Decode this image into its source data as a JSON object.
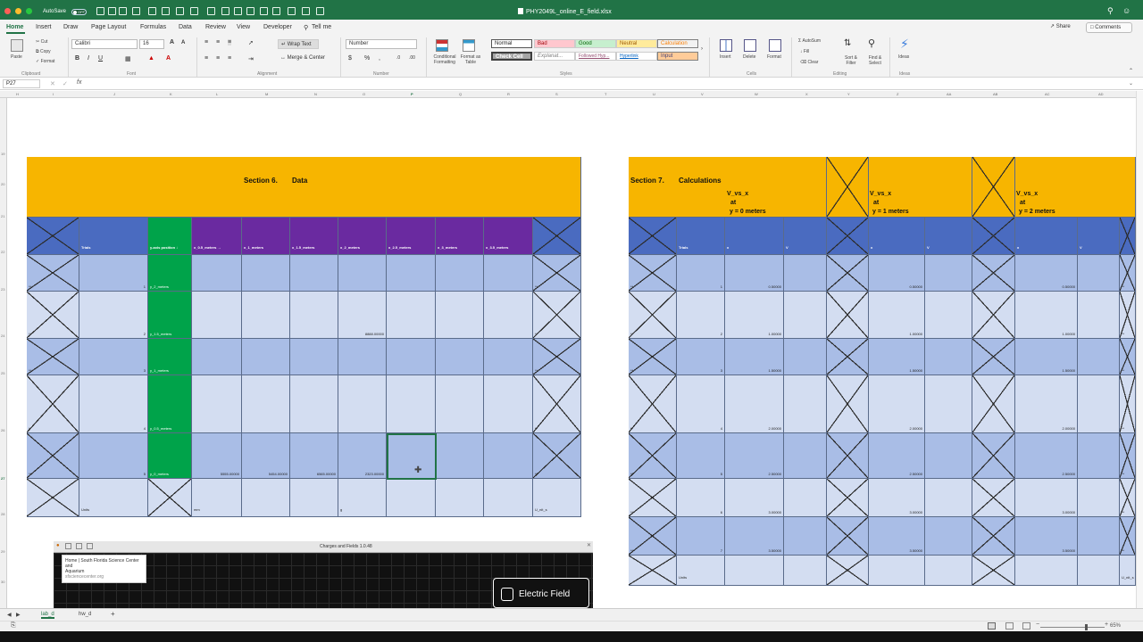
{
  "titlebar": {
    "autosave_label": "AutoSave",
    "autosave_state": "OFF",
    "document_title": "PHY2049L_online_E_field.xlsx"
  },
  "tabs": [
    "Home",
    "Insert",
    "Draw",
    "Page Layout",
    "Formulas",
    "Data",
    "Review",
    "View",
    "Developer",
    "Tell me"
  ],
  "share_label": "Share",
  "comments_label": "Comments",
  "ribbon": {
    "paste": "Paste",
    "cut": "Cut",
    "copy": "Copy",
    "format": "Format",
    "clipboard": "Clipboard",
    "font_name": "Calibri",
    "font_size": "16",
    "font_group": "Font",
    "wrap_text": "Wrap Text",
    "merge_center": "Merge & Center",
    "alignment_group": "Alignment",
    "number_format": "Number",
    "number_group": "Number",
    "conditional_formatting": "Conditional Formatting",
    "format_as_table": "Format as Table",
    "styles_group": "Styles",
    "styles": {
      "normal": "Normal",
      "bad": "Bad",
      "good": "Good",
      "neutral": "Neutral",
      "calculation": "Calculation",
      "check_cell": "Check Cell",
      "explanatory": "Explanat...",
      "followed_hyperlink": "Followed Hyp...",
      "hyperlink": "Hyperlink",
      "input": "Input"
    },
    "insert": "Insert",
    "delete": "Delete",
    "format_cells": "Format",
    "cells_group": "Cells",
    "autosum": "AutoSum",
    "fill": "Fill",
    "clear": "Clear",
    "sort_filter": "Sort & Filter",
    "find_select": "Find & Select",
    "editing_group": "Editing",
    "ideas": "Ideas",
    "ideas_group": "Ideas"
  },
  "formula_bar": {
    "name_box": "P27",
    "fx": "fx",
    "content": ""
  },
  "columns": [
    "H",
    "I",
    "J",
    "K",
    "L",
    "M",
    "N",
    "O",
    "P",
    "Q",
    "R",
    "S",
    "T",
    "U",
    "V",
    "W",
    "X",
    "Y",
    "Z",
    "AA",
    "AB",
    "AC",
    "AD"
  ],
  "rows": [
    "19",
    "20",
    "21",
    "22",
    "23",
    "24",
    "25",
    "26",
    "27",
    "28",
    "29",
    "30"
  ],
  "section6": {
    "title": "Section 6.",
    "subtitle": "Data",
    "headers": [
      "Trials",
      "y-axis position ↓",
      "x_0.5_meters →",
      "x_1_meters",
      "x_1.5_meters",
      "x_2_meters",
      "x_2.5_meters",
      "x_3_meters",
      "x_3.5_meters"
    ],
    "rows": [
      {
        "marker": "**",
        "trial": "1",
        "pos": "y_2_meters",
        "values": [
          "",
          "",
          "",
          "",
          "",
          "",
          ""
        ],
        "end": "**"
      },
      {
        "marker": "**",
        "trial": "2",
        "pos": "y_1.5_meters",
        "values": [
          "",
          "",
          "",
          "8888.00000",
          "",
          "",
          ""
        ],
        "end": "**"
      },
      {
        "marker": "**",
        "trial": "3",
        "pos": "y_1_meters",
        "values": [
          "",
          "",
          "",
          "",
          "",
          "",
          ""
        ],
        "end": "**"
      },
      {
        "marker": "**",
        "trial": "4",
        "pos": "y_0.5_meters",
        "values": [
          "",
          "",
          "",
          "",
          "",
          "",
          ""
        ],
        "end": "**"
      },
      {
        "marker": "**",
        "trial": "5",
        "pos": "y_0_meters",
        "values": [
          "5555.00000",
          "5454.00000",
          "6565.00000",
          "2323.00000",
          "",
          "",
          ""
        ],
        "end": "**"
      }
    ],
    "units_row": {
      "label": "Units",
      "col_l": "mm",
      "col_o": "g",
      "end": "U_nit_s"
    }
  },
  "section7": {
    "title": "Section 7.",
    "subtitle": "Calculations",
    "groups": [
      {
        "line1": "V_vs_x",
        "line2": "at",
        "line3": "y = 0 meters"
      },
      {
        "line1": "V_vs_x",
        "line2": "at",
        "line3": "y = 1 meters"
      },
      {
        "line1": "V_vs_x",
        "line2": "at",
        "line3": "y = 2 meters"
      }
    ],
    "headers": [
      "Trials",
      "x",
      "V",
      "x",
      "V",
      "x",
      "V"
    ],
    "rows": [
      {
        "marker": "**",
        "trial": "1",
        "x0": "0.50000",
        "x1": "0.50000",
        "x2": "0.50000",
        "end": "**"
      },
      {
        "marker": "**",
        "trial": "2",
        "x0": "1.00000",
        "x1": "1.00000",
        "x2": "1.00000",
        "end": "**"
      },
      {
        "marker": "**",
        "trial": "3",
        "x0": "1.50000",
        "x1": "1.50000",
        "x2": "1.50000",
        "end": "**"
      },
      {
        "marker": "**",
        "trial": "4",
        "x0": "2.00000",
        "x1": "2.00000",
        "x2": "2.00000",
        "end": "**"
      },
      {
        "marker": "**",
        "trial": "5",
        "x0": "2.50000",
        "x1": "2.50000",
        "x2": "2.50000",
        "end": "**"
      },
      {
        "marker": "**",
        "trial": "6",
        "x0": "3.00000",
        "x1": "3.00000",
        "x2": "3.00000",
        "end": "**"
      },
      {
        "marker": "**",
        "trial": "7",
        "x0": "3.50000",
        "x1": "3.50000",
        "x2": "3.50000",
        "end": "**"
      }
    ],
    "units_label": "Units",
    "units_end": "U_nit_s"
  },
  "overlay": {
    "window_title": "Charges and Fields 1.0.48",
    "tooltip_line1": "Home | South Florida Science Center and",
    "tooltip_line2": "Aquarium",
    "tooltip_url": "sfsciencecenter.org",
    "efield_label": "Electric Field"
  },
  "sheet_tabs": [
    "lab_d",
    "hw_d"
  ],
  "add_sheet": "+",
  "zoom": "65%"
}
